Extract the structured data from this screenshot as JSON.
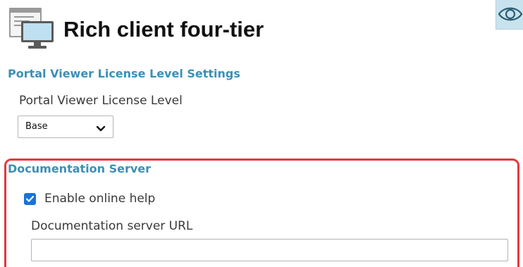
{
  "header": {
    "title": "Rich client four-tier",
    "app_icon": "client-monitor-icon",
    "view_icon": "eye-icon"
  },
  "license_section": {
    "heading": "Portal Viewer License Level Settings",
    "field_label": "Portal Viewer License Level",
    "selected_value": "Base",
    "dropdown_icon": "chevron-down-icon"
  },
  "documentation_section": {
    "heading": "Documentation Server",
    "checkbox_label": "Enable online help",
    "checkbox_checked": true,
    "url_label": "Documentation server URL",
    "url_value": ""
  },
  "colors": {
    "section_heading": "#3d8fb6",
    "highlight_border": "#e5393f",
    "checkbox": "#1a73d9",
    "view_button_bg": "#c9e3ee"
  }
}
